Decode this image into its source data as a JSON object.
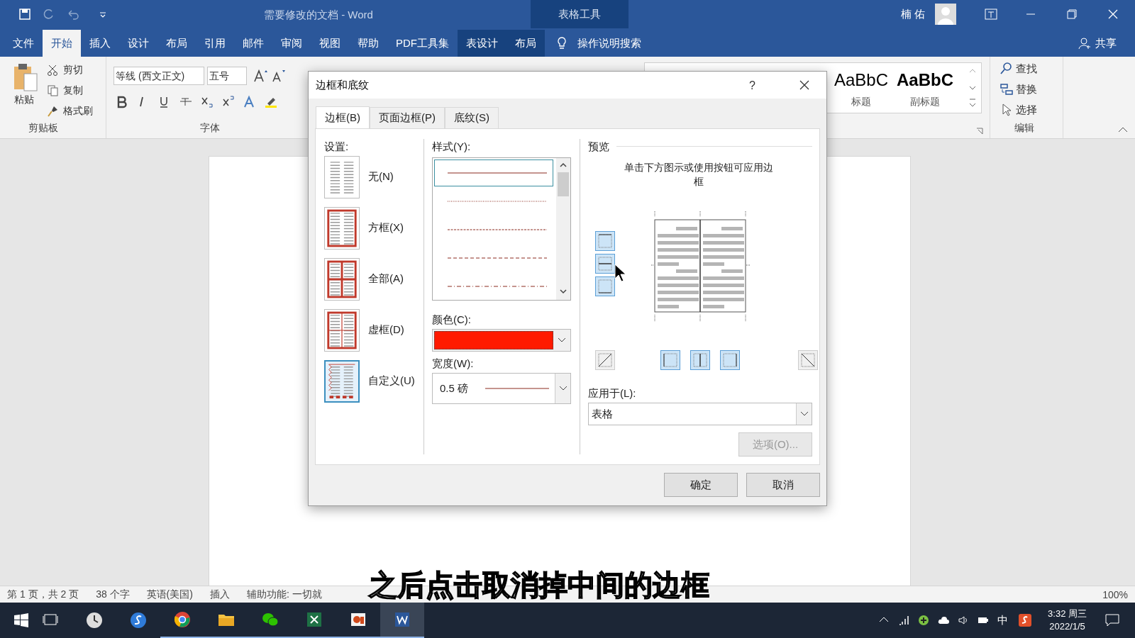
{
  "title_bar": {
    "title": "需要修改的文档  -  Word",
    "context_group": "表格工具",
    "user": "楠 佑"
  },
  "ribbon_tabs": [
    {
      "label": "文件",
      "selected": false,
      "contextual": false
    },
    {
      "label": "开始",
      "selected": true,
      "contextual": false
    },
    {
      "label": "插入",
      "selected": false,
      "contextual": false
    },
    {
      "label": "设计",
      "selected": false,
      "contextual": false
    },
    {
      "label": "布局",
      "selected": false,
      "contextual": false
    },
    {
      "label": "引用",
      "selected": false,
      "contextual": false
    },
    {
      "label": "邮件",
      "selected": false,
      "contextual": false
    },
    {
      "label": "审阅",
      "selected": false,
      "contextual": false
    },
    {
      "label": "视图",
      "selected": false,
      "contextual": false
    },
    {
      "label": "帮助",
      "selected": false,
      "contextual": false
    },
    {
      "label": "PDF工具集",
      "selected": false,
      "contextual": false
    },
    {
      "label": "表设计",
      "selected": false,
      "contextual": true
    },
    {
      "label": "布局",
      "selected": false,
      "contextual": true
    }
  ],
  "tell_me": "操作说明搜索",
  "share": "共享",
  "clipboard": {
    "paste": "粘贴",
    "items": [
      "剪切",
      "复制",
      "格式刷"
    ],
    "label": "剪贴板"
  },
  "font": {
    "name": "等线 (西文正文)",
    "size": "五号",
    "label": "字体"
  },
  "styles": [
    {
      "sample": "AaBbC",
      "label": "标题"
    },
    {
      "sample": "AaBbC",
      "label": "副标题"
    }
  ],
  "editing": {
    "items": [
      "查找",
      "替换",
      "选择"
    ],
    "label": "编辑"
  },
  "dialog": {
    "title": "边框和底纹",
    "help": "?",
    "tabs": [
      {
        "label": "边框(B)",
        "selected": true
      },
      {
        "label": "页面边框(P)",
        "selected": false
      },
      {
        "label": "底纹(S)",
        "selected": false
      }
    ],
    "settings": {
      "label": "设置:",
      "items": [
        {
          "label": "无(N)",
          "kind": "none",
          "selected": false
        },
        {
          "label": "方框(X)",
          "kind": "box",
          "selected": false
        },
        {
          "label": "全部(A)",
          "kind": "all",
          "selected": false
        },
        {
          "label": "虚框(D)",
          "kind": "grid",
          "selected": false
        },
        {
          "label": "自定义(U)",
          "kind": "custom",
          "selected": true
        }
      ]
    },
    "style": {
      "label": "样式(Y):",
      "lines": [
        {
          "kind": "solid",
          "selected": true
        },
        {
          "kind": "dotted",
          "selected": false
        },
        {
          "kind": "fine-dashed",
          "selected": false
        },
        {
          "kind": "dashed",
          "selected": false
        },
        {
          "kind": "dash-dot",
          "selected": false
        }
      ]
    },
    "color": {
      "label": "颜色(C):",
      "color": "#ff1a00"
    },
    "width": {
      "label": "宽度(W):",
      "value": "0.5 磅"
    },
    "preview": {
      "label": "预览",
      "hint": "单击下方图示或使用按钮可应用边框",
      "side_buttons": [
        {
          "kind": "top",
          "on": true
        },
        {
          "kind": "middle",
          "on": true
        },
        {
          "kind": "bottom",
          "on": true
        }
      ],
      "bottom_buttons": [
        {
          "kind": "diag-up",
          "on": false
        },
        {
          "kind": "left",
          "on": true
        },
        {
          "kind": "center",
          "on": true
        },
        {
          "kind": "right",
          "on": true
        },
        {
          "kind": "diag-down",
          "on": false
        }
      ]
    },
    "apply_to": {
      "label": "应用于(L):",
      "value": "表格"
    },
    "options": {
      "label": "选项(O)...",
      "disabled": true
    },
    "buttons": [
      "确定",
      "取消"
    ]
  },
  "status_bar": {
    "items": [
      "第 1 页，共 2 页",
      "38 个字",
      "英语(美国)",
      "插入",
      "辅助功能: 一切就"
    ],
    "zoom": "100%"
  },
  "taskbar": {
    "ime": "中",
    "time": "3:32 周三",
    "date": "2022/1/5"
  },
  "subtitle": "之后点击取消掉中间的边框"
}
